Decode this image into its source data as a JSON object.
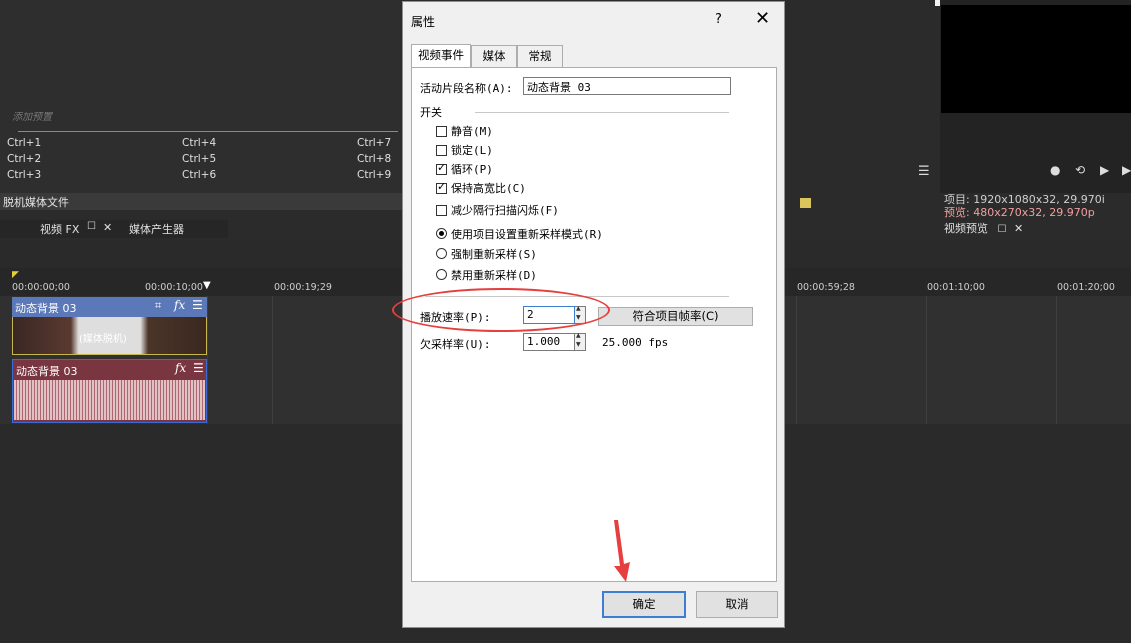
{
  "presets": {
    "hint": "添加预置",
    "col1": [
      "Ctrl+1",
      "Ctrl+2",
      "Ctrl+3"
    ],
    "col2": [
      "Ctrl+4",
      "Ctrl+5",
      "Ctrl+6"
    ],
    "col3": [
      "Ctrl+7",
      "Ctrl+8",
      "Ctrl+9"
    ]
  },
  "offline_label": "脱机媒体文件",
  "dock_tabs": {
    "video_fx": "视频 FX",
    "media_gen": "媒体产生器"
  },
  "timecodes": [
    "00:00:00;00",
    "00:00:10;00",
    "00:00:19;29",
    "00:00:59;28",
    "00:01:10;00",
    "00:01:20;00"
  ],
  "tracks": {
    "video_clip_title": "动态背景 03",
    "video_clip_offline": "(媒体脱机)",
    "audio_clip_title": "动态背景 03"
  },
  "project": {
    "line1": "项目: 1920x1080x32, 29.970i",
    "line2": "预览: 480x270x32, 29.970p",
    "preview_tab": "视频预览"
  },
  "dialog": {
    "title": "属性",
    "help": "?",
    "close": "✕",
    "tabs": [
      "视频事件",
      "媒体",
      "常规"
    ],
    "clip_name_label": "活动片段名称(A):",
    "clip_name_value": "动态背景 03",
    "switch_group": "开关",
    "switches": [
      {
        "label": "静音(M)",
        "checked": false
      },
      {
        "label": "锁定(L)",
        "checked": false
      },
      {
        "label": "循环(P)",
        "checked": true
      },
      {
        "label": "保持高宽比(C)",
        "checked": true
      },
      {
        "label": "减少隔行扫描闪烁(F)",
        "checked": false
      }
    ],
    "resample": [
      {
        "label": "使用项目设置重新采样模式(R)",
        "selected": true
      },
      {
        "label": "强制重新采样(S)",
        "selected": false
      },
      {
        "label": "禁用重新采样(D)",
        "selected": false
      }
    ],
    "playback_rate_label": "播放速率(P):",
    "playback_rate_value": "2",
    "match_fps_button": "符合项目帧率(C)",
    "undersample_label": "欠采样率(U):",
    "undersample_value": "1.000",
    "fps_readout": "25.000 fps",
    "ok_button": "确定",
    "cancel_button": "取消"
  },
  "colors": {
    "annotation": "#e5403f",
    "accent_blue": "#3c7fd1"
  }
}
